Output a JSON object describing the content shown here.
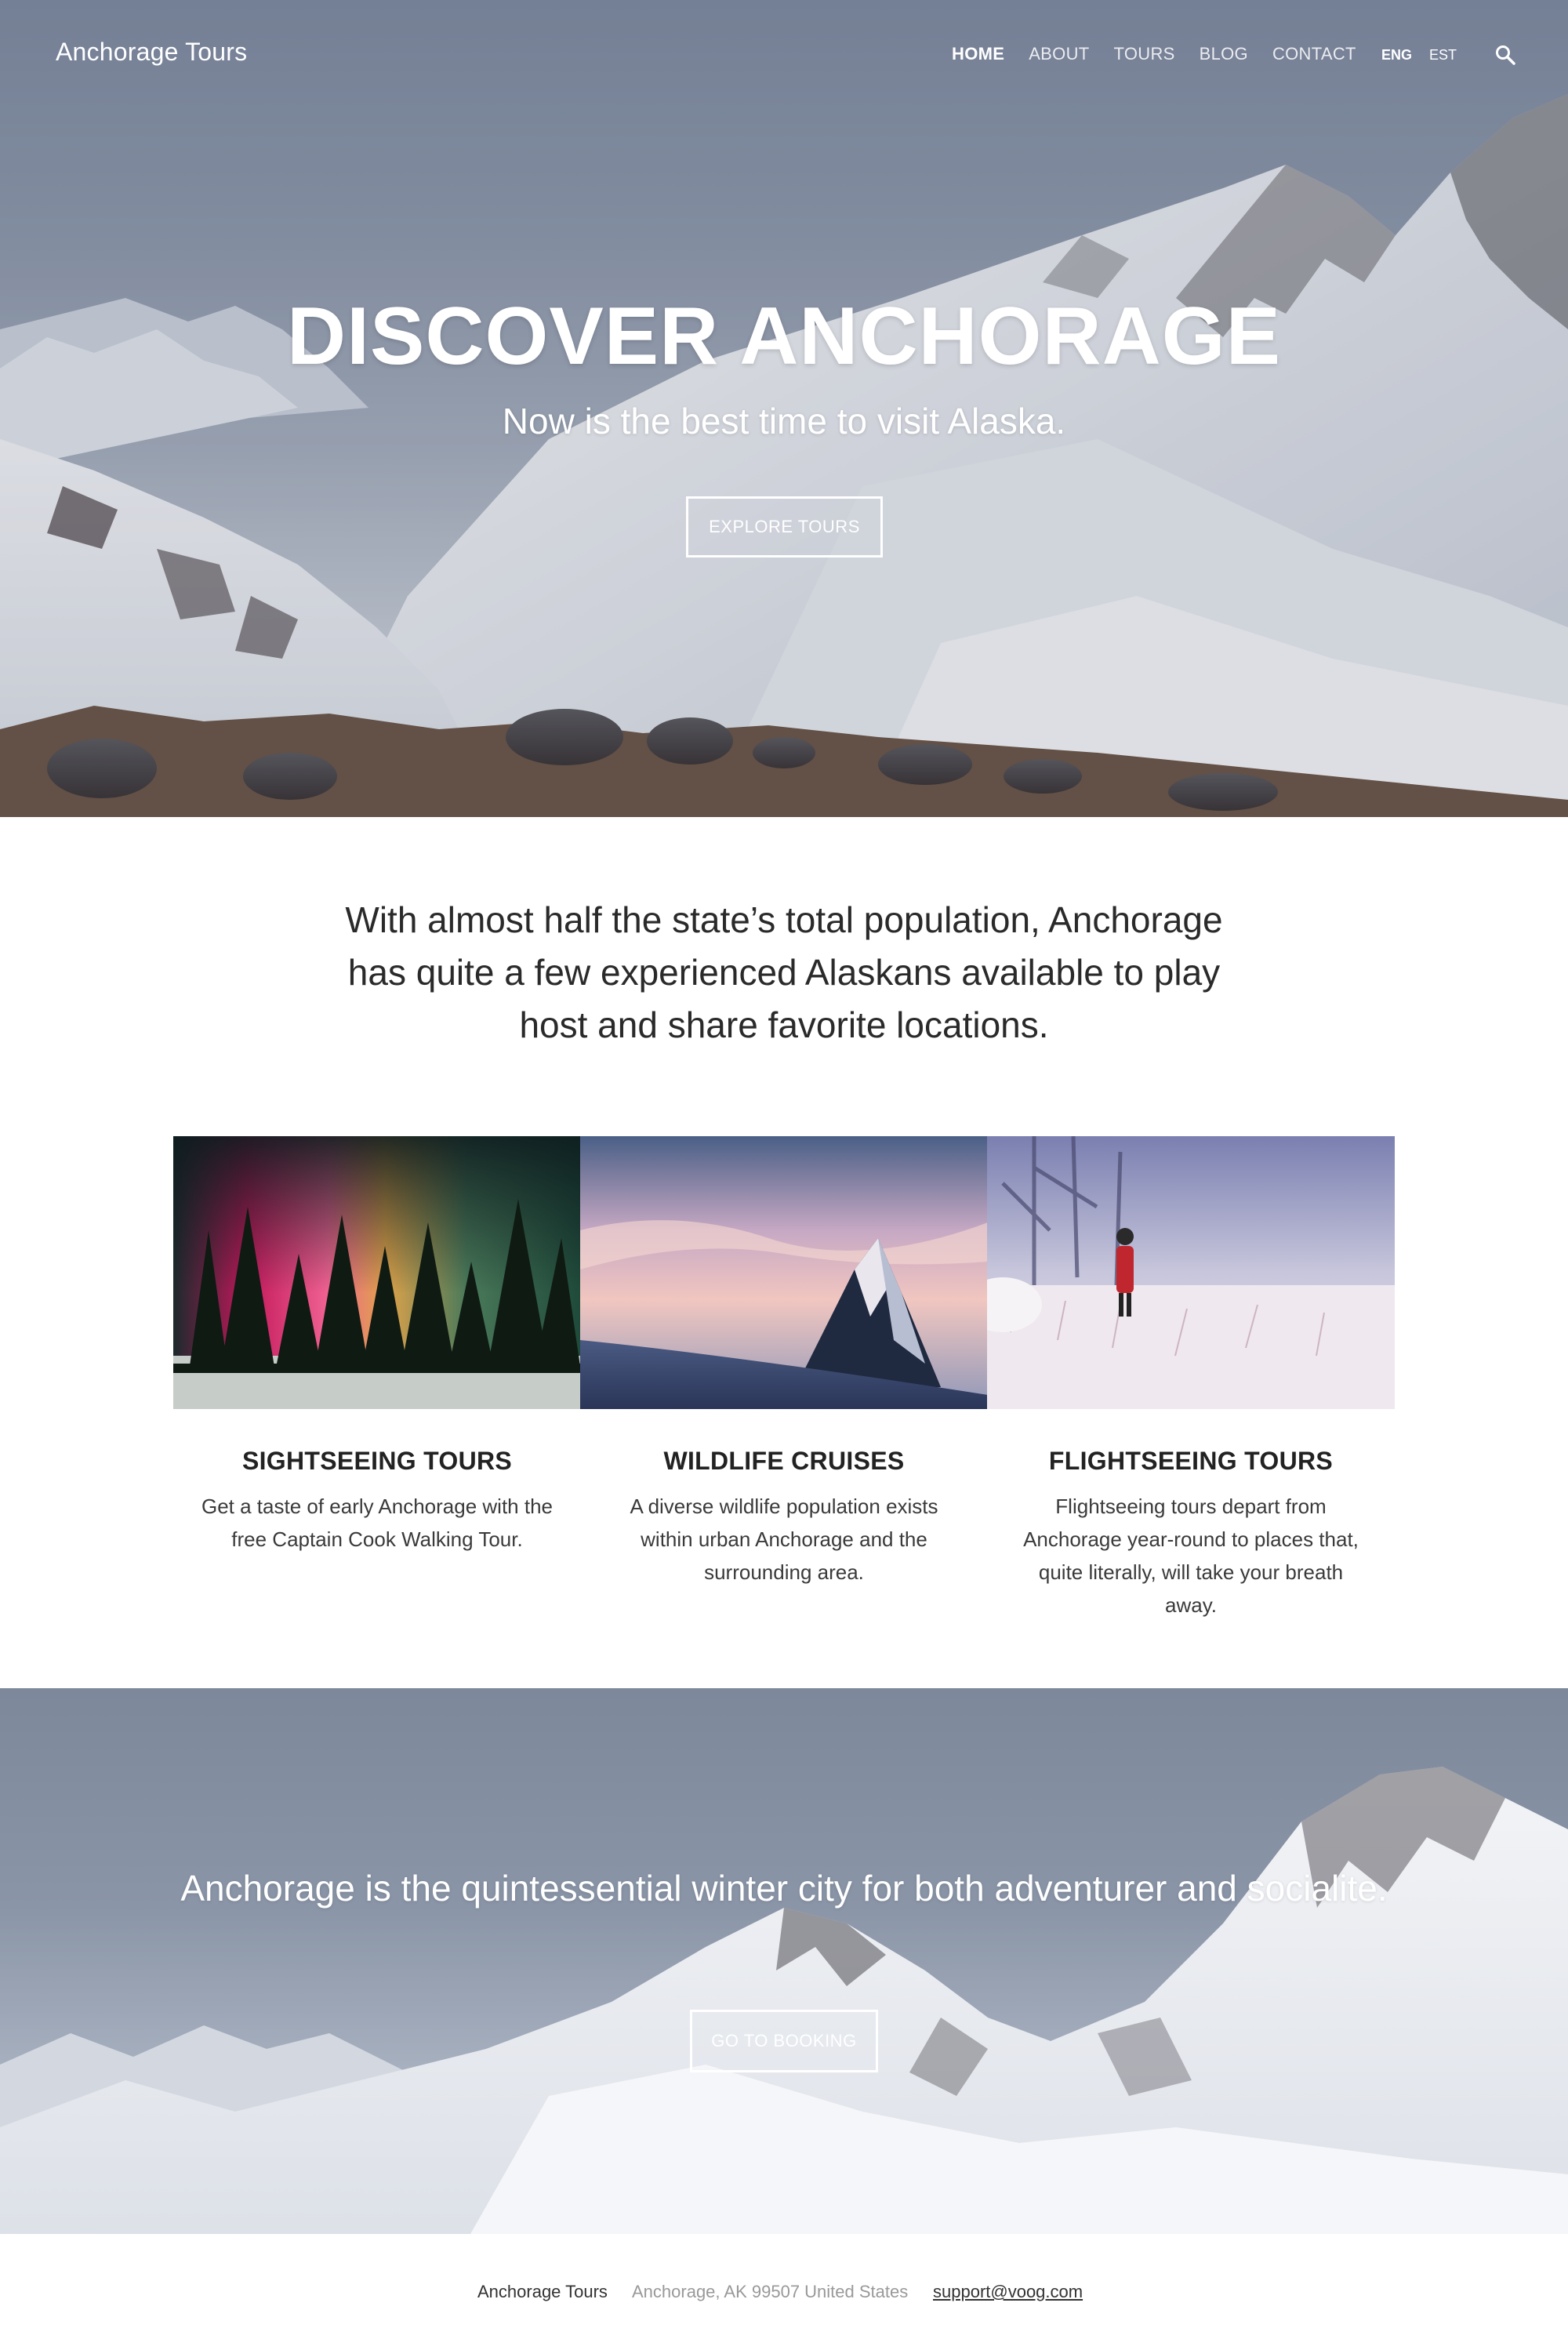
{
  "header": {
    "logo": "Anchorage Tours",
    "nav": [
      "HOME",
      "ABOUT",
      "TOURS",
      "BLOG",
      "CONTACT"
    ],
    "active_nav": "HOME",
    "languages": [
      "ENG",
      "EST"
    ],
    "active_language": "ENG",
    "search_icon": "search-icon"
  },
  "hero": {
    "title": "DISCOVER ANCHORAGE",
    "subtitle": "Now is the best time to visit Alaska.",
    "button": "EXPLORE TOURS"
  },
  "intro": {
    "text": "With almost half the state’s total population, Anchorage has quite a few experienced Alaskans available to play host and share favorite locations."
  },
  "cards": [
    {
      "title": "SIGHTSEEING TOURS",
      "text": "Get a taste of early Anchorage with the free Captain Cook Walking Tour."
    },
    {
      "title": "WILDLIFE CRUISES",
      "text": "A diverse wildlife population exists within urban Anchorage and the surrounding area."
    },
    {
      "title": "FLIGHTSEEING TOURS",
      "text": "Flightseeing tours depart from Anchorage year-round to places that, quite literally, will take your breath away."
    }
  ],
  "booking": {
    "text": "Anchorage is the quintessential winter city for both adventurer and socialite.",
    "button": "GO TO BOOKING"
  },
  "footer": {
    "name": "Anchorage Tours",
    "address": "Anchorage, AK 99507 United States",
    "email": "support@voog.com"
  },
  "colors": {
    "text_dark": "#222222",
    "text_muted": "#999999",
    "button_border": "#ffffff"
  }
}
